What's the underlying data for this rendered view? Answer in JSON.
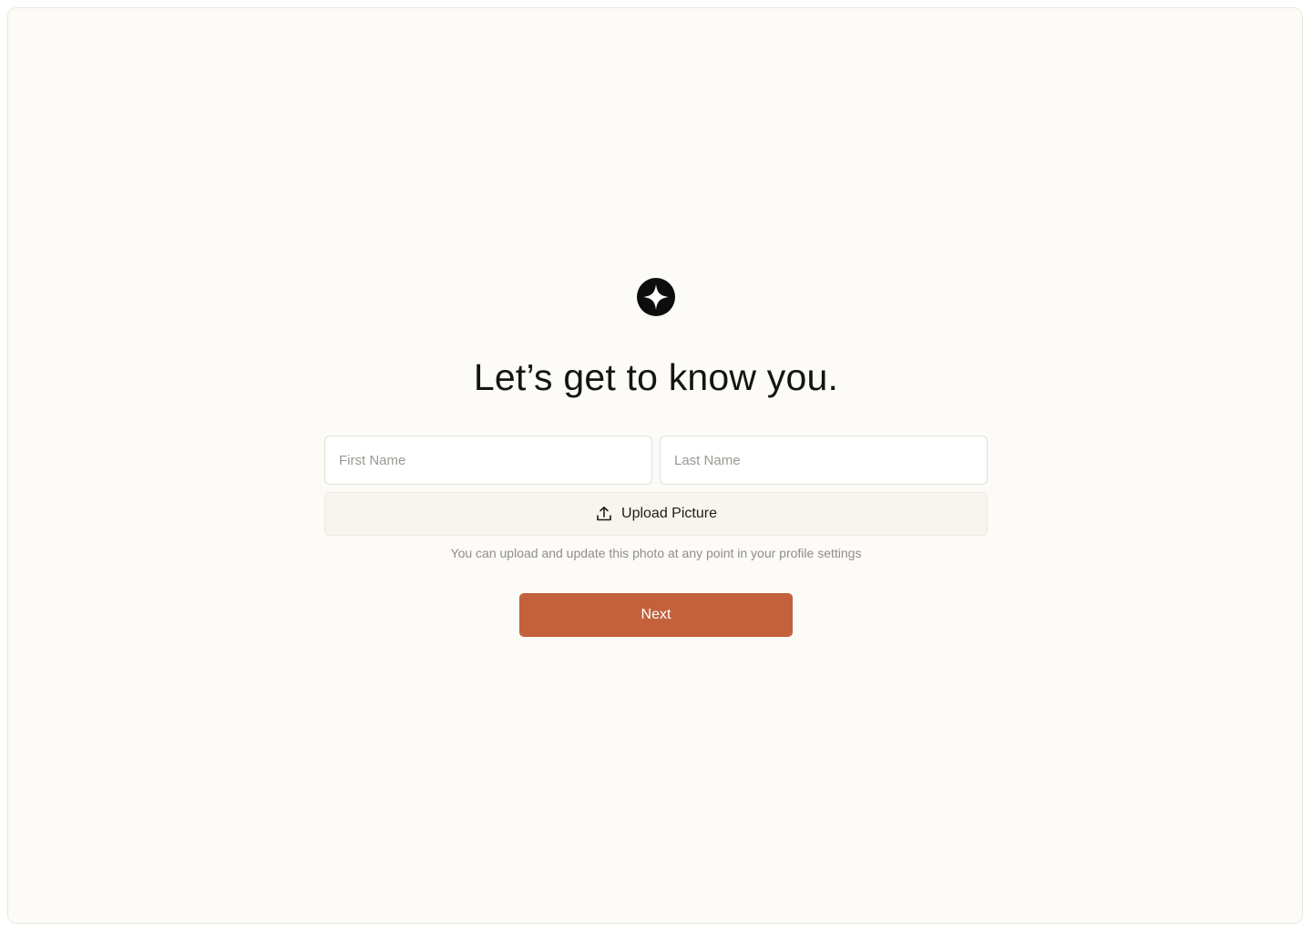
{
  "logo": {
    "icon": "sparkle-star-icon",
    "color": "#0d0d0d"
  },
  "heading": "Let’s get to know you.",
  "form": {
    "first_name": {
      "placeholder": "First Name",
      "value": ""
    },
    "last_name": {
      "placeholder": "Last Name",
      "value": ""
    },
    "upload": {
      "icon": "upload-icon",
      "label": "Upload Picture"
    },
    "helper_text": "You can upload and update this photo at any point in your profile settings",
    "next_label": "Next"
  },
  "colors": {
    "background": "#fcfbf7",
    "accent": "#c2613c",
    "upload_bg": "#f8f5ee"
  }
}
